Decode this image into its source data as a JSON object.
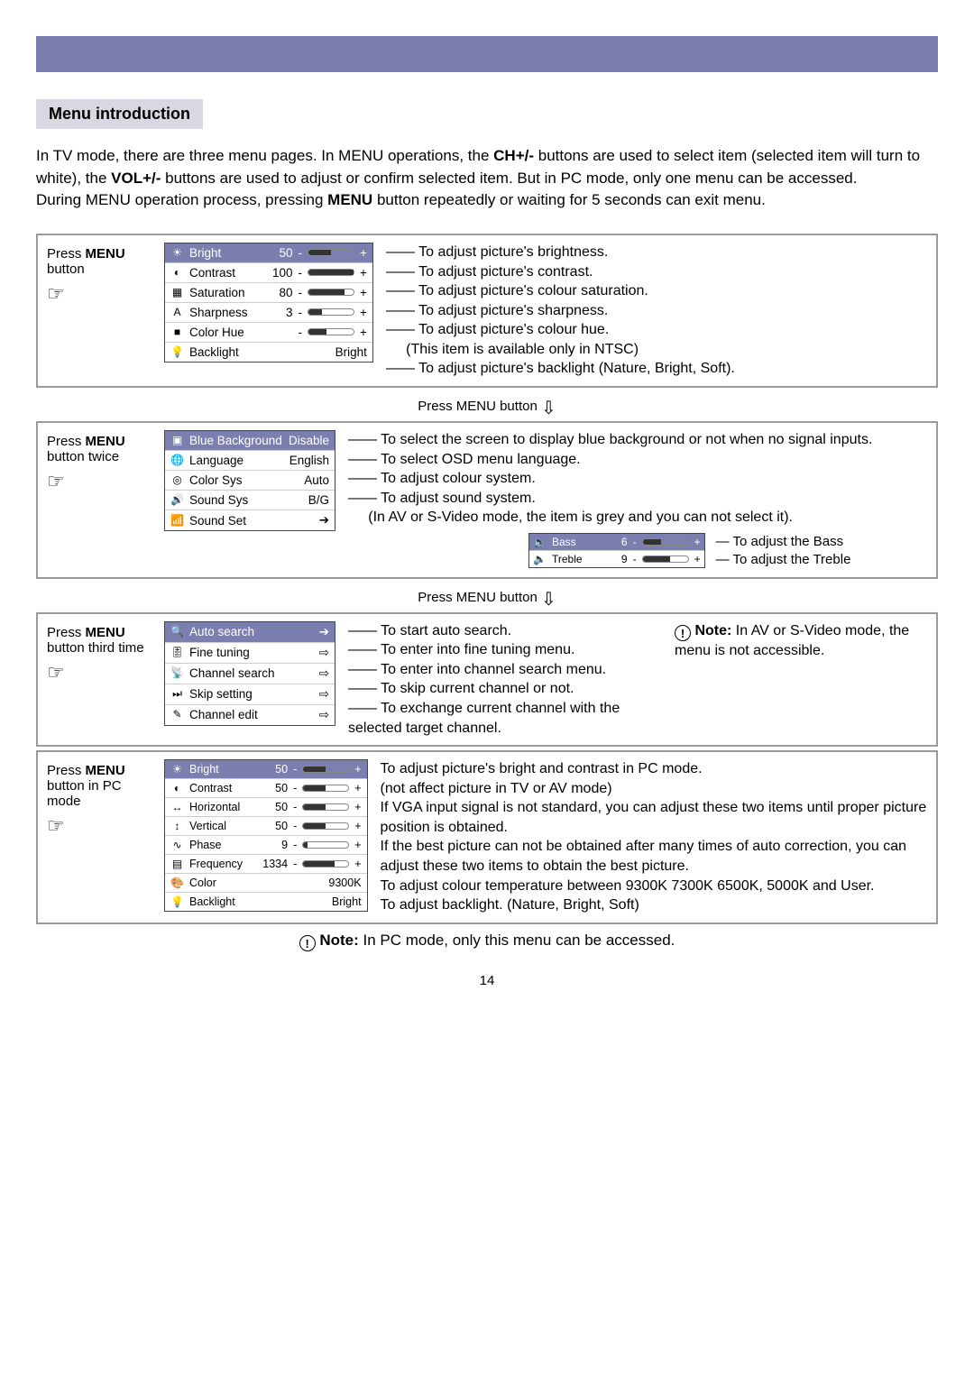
{
  "banner": {},
  "heading": "Menu introduction",
  "intro": {
    "p1a": "In TV mode, there are three menu pages. In MENU operations, the ",
    "ch": "CH+/-",
    "p1b": " buttons are used to select item (selected item will turn to white), the ",
    "vol": "VOL+/-",
    "p1c": " buttons are used to adjust or confirm selected item. But in PC mode, only one menu can be accessed.",
    "p2a": "During MENU operation process, pressing ",
    "menu": "MENU",
    "p2b": " button repeatedly or waiting for 5 seconds can exit menu."
  },
  "press_labels": {
    "p1_pre": "Press ",
    "p1_bold": "MENU",
    "p1_post": " button",
    "p2_pre": "Press ",
    "p2_bold": "MENU",
    "p2_post": " button twice",
    "p3_pre": "Press ",
    "p3_bold": "MENU",
    "p3_post": " button third time",
    "p4_pre": "Press ",
    "p4_bold": "MENU",
    "p4_post": " button in PC mode"
  },
  "sep_label": "Press MENU button",
  "menus": {
    "m1": {
      "rows": [
        {
          "ico": "☀",
          "label": "Bright",
          "val": "50",
          "slider": 50,
          "desc": "To adjust picture's brightness."
        },
        {
          "ico": "◐",
          "label": "Contrast",
          "val": "100",
          "slider": 100,
          "desc": "To adjust picture's contrast."
        },
        {
          "ico": "▦",
          "label": "Saturation",
          "val": "80",
          "slider": 80,
          "desc": "To adjust picture's colour saturation."
        },
        {
          "ico": "A",
          "label": "Sharpness",
          "val": "3",
          "slider": 30,
          "desc": "To adjust picture's sharpness."
        },
        {
          "ico": "■",
          "label": "Color Hue",
          "val": "",
          "slider": 40,
          "desc": "To adjust picture's colour hue.",
          "sub": "(This item is available only in NTSC)"
        },
        {
          "ico": "💡",
          "label": "Backlight",
          "val": "Bright",
          "desc": "To adjust picture's backlight (Nature, Bright, Soft)."
        }
      ]
    },
    "m2": {
      "rows": [
        {
          "ico": "▣",
          "label": "Blue Background",
          "val": "Disable",
          "desc": "To select the screen to display blue background or not when no signal inputs."
        },
        {
          "ico": "🌐",
          "label": "Language",
          "val": "English",
          "desc": "To select OSD menu language."
        },
        {
          "ico": "◎",
          "label": "Color Sys",
          "val": "Auto",
          "desc": "To adjust colour system."
        },
        {
          "ico": "🔊",
          "label": "Sound Sys",
          "val": "B/G",
          "desc": "To adjust sound system.",
          "sub": "(In AV or S-Video mode, the item is grey and you can not select it)."
        },
        {
          "ico": "📶",
          "label": "Sound Set",
          "val": "➔"
        }
      ],
      "sound_sub": {
        "rows": [
          {
            "ico": "🔈",
            "label": "Bass",
            "val": "6",
            "slider": 40,
            "desc": "To adjust the Bass"
          },
          {
            "ico": "🔈",
            "label": "Treble",
            "val": "9",
            "slider": 60,
            "desc": "To adjust the Treble"
          }
        ]
      }
    },
    "m3": {
      "rows": [
        {
          "ico": "🔍",
          "label": "Auto search",
          "open": true,
          "desc": "To start auto search."
        },
        {
          "ico": "🎚",
          "label": "Fine tuning",
          "open": true,
          "desc": "To enter into fine tuning menu."
        },
        {
          "ico": "📡",
          "label": "Channel search",
          "open": true,
          "desc": "To enter into channel search menu."
        },
        {
          "ico": "⏭",
          "label": "Skip setting",
          "open": true,
          "desc": "To skip current channel or not."
        },
        {
          "ico": "✎",
          "label": "Channel edit",
          "open": true,
          "desc": "To  exchange current channel with the selected target channel."
        }
      ],
      "note_bold": "Note:",
      "note": " In AV or S-Video mode, the menu is not accessible."
    },
    "m4": {
      "rows": [
        {
          "ico": "☀",
          "label": "Bright",
          "val": "50",
          "slider": 50
        },
        {
          "ico": "◐",
          "label": "Contrast",
          "val": "50",
          "slider": 50
        },
        {
          "ico": "↔",
          "label": "Horizontal",
          "val": "50",
          "slider": 50
        },
        {
          "ico": "↕",
          "label": "Vertical",
          "val": "50",
          "slider": 50
        },
        {
          "ico": "∿",
          "label": "Phase",
          "val": "9",
          "slider": 9
        },
        {
          "ico": "▤",
          "label": "Frequency",
          "val": "1334",
          "slider": 70
        },
        {
          "ico": "🎨",
          "label": "Color",
          "val": "9300K"
        },
        {
          "ico": "💡",
          "label": "Backlight",
          "val": "Bright"
        }
      ],
      "desc": [
        "To adjust picture's bright and contrast in PC mode.",
        "(not affect picture in TV or AV mode)",
        "If VGA input signal is not standard, you can adjust these two items until proper picture position is obtained.",
        "If the best picture can not be obtained after many times of auto correction, you can adjust these two items to obtain the best picture.",
        "To adjust colour temperature between 9300K 7300K 6500K, 5000K and User.",
        "To adjust backlight. (Nature, Bright, Soft)"
      ],
      "note_bold": "Note:",
      "note": " In PC mode, only this menu can be accessed."
    }
  },
  "page_number": "14"
}
